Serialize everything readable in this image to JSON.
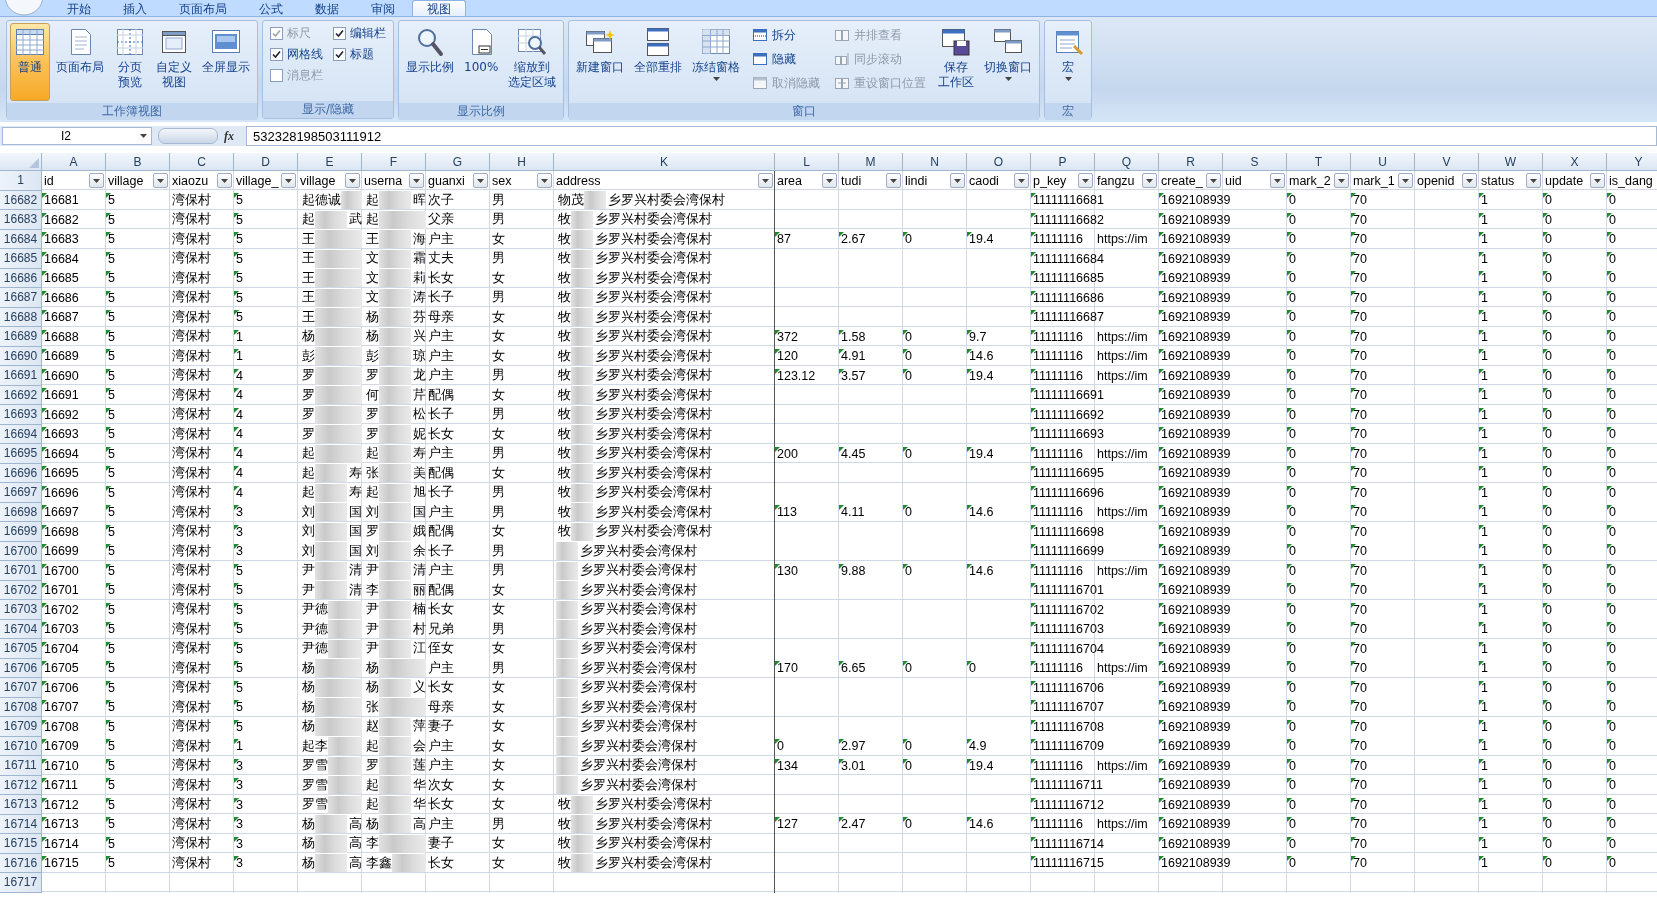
{
  "ribbon": {
    "tabs": [
      {
        "label": "开始",
        "selected": false
      },
      {
        "label": "插入",
        "selected": false
      },
      {
        "label": "页面布局",
        "selected": false
      },
      {
        "label": "公式",
        "selected": false
      },
      {
        "label": "数据",
        "selected": false
      },
      {
        "label": "审阅",
        "selected": false
      },
      {
        "label": "视图",
        "selected": true
      }
    ],
    "groups": [
      {
        "title": "工作簿视图",
        "items": [
          {
            "kind": "large",
            "label": [
              "普通"
            ],
            "selected": true
          },
          {
            "kind": "large",
            "label": [
              "页面布局"
            ],
            "selected": false
          },
          {
            "kind": "large",
            "label": [
              "分页",
              "预览"
            ],
            "selected": false
          },
          {
            "kind": "large",
            "label": [
              "自定义",
              "视图"
            ],
            "selected": false
          },
          {
            "kind": "large",
            "label": [
              "全屏显示"
            ],
            "selected": false
          }
        ]
      },
      {
        "title": "显示/隐藏",
        "items": [
          {
            "kind": "check",
            "label": "标尺",
            "checked": true,
            "disabled": true
          },
          {
            "kind": "check",
            "label": "网格线",
            "checked": true,
            "disabled": false
          },
          {
            "kind": "check",
            "label": "消息栏",
            "checked": false,
            "disabled": true
          },
          {
            "kind": "check",
            "label": "编辑栏",
            "checked": true,
            "disabled": false
          },
          {
            "kind": "check",
            "label": "标题",
            "checked": true,
            "disabled": false
          }
        ]
      },
      {
        "title": "显示比例",
        "items": [
          {
            "kind": "large",
            "label": [
              "显示比例"
            ],
            "selected": false
          },
          {
            "kind": "large",
            "label": [
              "100%"
            ],
            "selected": false
          },
          {
            "kind": "large",
            "label": [
              "缩放到",
              "选定区域"
            ],
            "selected": false
          }
        ]
      },
      {
        "title": "窗口",
        "items": [
          {
            "kind": "large",
            "label": [
              "新建窗口"
            ],
            "selected": false
          },
          {
            "kind": "large",
            "label": [
              "全部重排"
            ],
            "selected": false
          },
          {
            "kind": "large",
            "label": [
              "冻结窗格"
            ],
            "selected": false,
            "dropdown": true
          },
          {
            "kind": "small",
            "label": "拆分",
            "disabled": false
          },
          {
            "kind": "small",
            "label": "隐藏",
            "disabled": false
          },
          {
            "kind": "small",
            "label": "取消隐藏",
            "disabled": true
          },
          {
            "kind": "small",
            "label": "并排查看",
            "disabled": true
          },
          {
            "kind": "small",
            "label": "同步滚动",
            "disabled": true
          },
          {
            "kind": "small",
            "label": "重设窗口位置",
            "disabled": true
          },
          {
            "kind": "large",
            "label": [
              "保存",
              "工作区"
            ],
            "selected": false
          },
          {
            "kind": "large",
            "label": [
              "切换窗口"
            ],
            "selected": false,
            "dropdown": true
          }
        ]
      },
      {
        "title": "宏",
        "items": [
          {
            "kind": "large",
            "label": [
              "宏"
            ],
            "selected": false,
            "dropdown": true
          }
        ]
      }
    ]
  },
  "formula_bar": {
    "name_box": "I2",
    "function_label": "fx",
    "value": "532328198503111912"
  },
  "sheet": {
    "columns": [
      {
        "letter": "A",
        "header": "id",
        "filter": true,
        "flagged": true
      },
      {
        "letter": "B",
        "header": "village",
        "filter": true,
        "flagged": true
      },
      {
        "letter": "C",
        "header": "xiaozu",
        "filter": true,
        "flagged": false
      },
      {
        "letter": "D",
        "header": "village_",
        "filter": true,
        "flagged": true
      },
      {
        "letter": "E",
        "header": "village",
        "filter": true,
        "flagged": false
      },
      {
        "letter": "F",
        "header": "userna",
        "filter": true,
        "flagged": false
      },
      {
        "letter": "G",
        "header": "guanxi",
        "filter": true,
        "flagged": false
      },
      {
        "letter": "H",
        "header": "sex",
        "filter": true,
        "flagged": false
      },
      {
        "letter": "K",
        "header": "address",
        "filter": true,
        "flagged": false
      },
      {
        "letter": "L",
        "header": "area",
        "filter": true,
        "flagged": true
      },
      {
        "letter": "M",
        "header": "tudi",
        "filter": true,
        "flagged": true
      },
      {
        "letter": "N",
        "header": "lindi",
        "filter": true,
        "flagged": true
      },
      {
        "letter": "O",
        "header": "caodi",
        "filter": true,
        "flagged": true
      },
      {
        "letter": "P",
        "header": "p_key",
        "filter": true,
        "flagged": true
      },
      {
        "letter": "Q",
        "header": "fangzu",
        "filter": true,
        "flagged": false
      },
      {
        "letter": "R",
        "header": "create_",
        "filter": true,
        "flagged": true
      },
      {
        "letter": "S",
        "header": "uid",
        "filter": true
      },
      {
        "letter": "T",
        "header": "mark_2",
        "filter": true,
        "flagged": true
      },
      {
        "letter": "U",
        "header": "mark_1",
        "filter": true,
        "flagged": true
      },
      {
        "letter": "V",
        "header": "openid",
        "filter": true
      },
      {
        "letter": "W",
        "header": "status",
        "filter": true,
        "flagged": true
      },
      {
        "letter": "X",
        "header": "update",
        "filter": true,
        "flagged": true
      },
      {
        "letter": "Y",
        "header": "is_dang",
        "filter": false,
        "flagged": true
      }
    ],
    "header_row": "1",
    "rows": [
      {
        "row": "16682",
        "cells": [
          "16681",
          "5",
          "湾保村",
          "5",
          [
            "起德诚"
          ],
          [
            "起",
            "晖"
          ],
          "次子",
          "男",
          [
            "物茂",
            "乡罗兴村委会湾保村"
          ],
          null,
          null,
          null,
          null,
          "11111116681",
          null,
          "1692108939",
          null,
          "0",
          "70",
          null,
          "1",
          "0",
          "0"
        ]
      },
      {
        "row": "16683",
        "cells": [
          "16682",
          "5",
          "湾保村",
          "5",
          [
            "起",
            "武"
          ],
          [
            "起"
          ],
          "父亲",
          "男",
          [
            "牧",
            "乡罗兴村委会湾保村"
          ],
          null,
          null,
          null,
          null,
          "11111116682",
          null,
          "1692108939",
          null,
          "0",
          "70",
          null,
          "1",
          "0",
          "0"
        ]
      },
      {
        "row": "16684",
        "cells": [
          "16683",
          "5",
          "湾保村",
          "5",
          [
            "王"
          ],
          [
            "王",
            "海"
          ],
          "户主",
          "女",
          [
            "牧",
            "乡罗兴村委会湾保村"
          ],
          "87",
          "2.67",
          "0",
          "19.4",
          "11111116",
          "https://im",
          "1692108939",
          null,
          "0",
          "70",
          null,
          "1",
          "0",
          "0"
        ]
      },
      {
        "row": "16685",
        "cells": [
          "16684",
          "5",
          "湾保村",
          "5",
          [
            "王"
          ],
          [
            "文",
            "霜"
          ],
          "丈夫",
          "男",
          [
            "牧",
            "乡罗兴村委会湾保村"
          ],
          null,
          null,
          null,
          null,
          "11111116684",
          null,
          "1692108939",
          null,
          "0",
          "70",
          null,
          "1",
          "0",
          "0"
        ]
      },
      {
        "row": "16686",
        "cells": [
          "16685",
          "5",
          "湾保村",
          "5",
          [
            "王"
          ],
          [
            "文",
            "莉"
          ],
          "长女",
          "女",
          [
            "牧",
            "乡罗兴村委会湾保村"
          ],
          null,
          null,
          null,
          null,
          "11111116685",
          null,
          "1692108939",
          null,
          "0",
          "70",
          null,
          "1",
          "0",
          "0"
        ]
      },
      {
        "row": "16687",
        "cells": [
          "16686",
          "5",
          "湾保村",
          "5",
          [
            "王"
          ],
          [
            "文",
            "涛"
          ],
          "长子",
          "男",
          [
            "牧",
            "乡罗兴村委会湾保村"
          ],
          null,
          null,
          null,
          null,
          "11111116686",
          null,
          "1692108939",
          null,
          "0",
          "70",
          null,
          "1",
          "0",
          "0"
        ]
      },
      {
        "row": "16688",
        "cells": [
          "16687",
          "5",
          "湾保村",
          "5",
          [
            "王"
          ],
          [
            "杨",
            "芬"
          ],
          "母亲",
          "女",
          [
            "牧",
            "乡罗兴村委会湾保村"
          ],
          null,
          null,
          null,
          null,
          "11111116687",
          null,
          "1692108939",
          null,
          "0",
          "70",
          null,
          "1",
          "0",
          "0"
        ]
      },
      {
        "row": "16689",
        "cells": [
          "16688",
          "5",
          "湾保村",
          "1",
          [
            "杨"
          ],
          [
            "杨",
            "兴"
          ],
          "户主",
          "女",
          [
            "牧",
            "乡罗兴村委会湾保村"
          ],
          "372",
          "1.58",
          "0",
          "9.7",
          "11111116",
          "https://im",
          "1692108939",
          null,
          "0",
          "70",
          null,
          "1",
          "0",
          "0"
        ]
      },
      {
        "row": "16690",
        "cells": [
          "16689",
          "5",
          "湾保村",
          "1",
          [
            "彭"
          ],
          [
            "彭",
            "琼"
          ],
          "户主",
          "女",
          [
            "牧",
            "乡罗兴村委会湾保村"
          ],
          "120",
          "4.91",
          "0",
          "14.6",
          "11111116",
          "https://im",
          "1692108939",
          null,
          "0",
          "70",
          null,
          "1",
          "0",
          "0"
        ]
      },
      {
        "row": "16691",
        "cells": [
          "16690",
          "5",
          "湾保村",
          "4",
          [
            "罗"
          ],
          [
            "罗",
            "龙"
          ],
          "户主",
          "男",
          [
            "牧",
            "乡罗兴村委会湾保村"
          ],
          "123.12",
          "3.57",
          "0",
          "19.4",
          "11111116",
          "https://im",
          "1692108939",
          null,
          "0",
          "70",
          null,
          "1",
          "0",
          "0"
        ]
      },
      {
        "row": "16692",
        "cells": [
          "16691",
          "5",
          "湾保村",
          "4",
          [
            "罗"
          ],
          [
            "何",
            "芹"
          ],
          "配偶",
          "女",
          [
            "牧",
            "乡罗兴村委会湾保村"
          ],
          null,
          null,
          null,
          null,
          "11111116691",
          null,
          "1692108939",
          null,
          "0",
          "70",
          null,
          "1",
          "0",
          "0"
        ]
      },
      {
        "row": "16693",
        "cells": [
          "16692",
          "5",
          "湾保村",
          "4",
          [
            "罗"
          ],
          [
            "罗",
            "松"
          ],
          "长子",
          "男",
          [
            "牧",
            "乡罗兴村委会湾保村"
          ],
          null,
          null,
          null,
          null,
          "11111116692",
          null,
          "1692108939",
          null,
          "0",
          "70",
          null,
          "1",
          "0",
          "0"
        ]
      },
      {
        "row": "16694",
        "cells": [
          "16693",
          "5",
          "湾保村",
          "4",
          [
            "罗"
          ],
          [
            "罗",
            "妮"
          ],
          "长女",
          "女",
          [
            "牧",
            "乡罗兴村委会湾保村"
          ],
          null,
          null,
          null,
          null,
          "11111116693",
          null,
          "1692108939",
          null,
          "0",
          "70",
          null,
          "1",
          "0",
          "0"
        ]
      },
      {
        "row": "16695",
        "cells": [
          "16694",
          "5",
          "湾保村",
          "4",
          [
            "起"
          ],
          [
            "起",
            "寿"
          ],
          "户主",
          "男",
          [
            "牧",
            "乡罗兴村委会湾保村"
          ],
          "200",
          "4.45",
          "0",
          "19.4",
          "11111116",
          "https://im",
          "1692108939",
          null,
          "0",
          "70",
          null,
          "1",
          "0",
          "0"
        ]
      },
      {
        "row": "16696",
        "cells": [
          "16695",
          "5",
          "湾保村",
          "4",
          [
            "起",
            "寿"
          ],
          [
            "张",
            "美"
          ],
          "配偶",
          "女",
          [
            "牧",
            "乡罗兴村委会湾保村"
          ],
          null,
          null,
          null,
          null,
          "11111116695",
          null,
          "1692108939",
          null,
          "0",
          "70",
          null,
          "1",
          "0",
          "0"
        ]
      },
      {
        "row": "16697",
        "cells": [
          "16696",
          "5",
          "湾保村",
          "4",
          [
            "起",
            "寿"
          ],
          [
            "起",
            "旭"
          ],
          "长子",
          "男",
          [
            "牧",
            "乡罗兴村委会湾保村"
          ],
          null,
          null,
          null,
          null,
          "11111116696",
          null,
          "1692108939",
          null,
          "0",
          "70",
          null,
          "1",
          "0",
          "0"
        ]
      },
      {
        "row": "16698",
        "cells": [
          "16697",
          "5",
          "湾保村",
          "3",
          [
            "刘",
            "国"
          ],
          [
            "刘",
            "国"
          ],
          "户主",
          "男",
          [
            "牧",
            "乡罗兴村委会湾保村"
          ],
          "113",
          "4.11",
          "0",
          "14.6",
          "11111116",
          "https://im",
          "1692108939",
          null,
          "0",
          "70",
          null,
          "1",
          "0",
          "0"
        ]
      },
      {
        "row": "16699",
        "cells": [
          "16698",
          "5",
          "湾保村",
          "3",
          [
            "刘",
            "国"
          ],
          [
            "罗",
            "娥"
          ],
          "配偶",
          "女",
          [
            "牧",
            "乡罗兴村委会湾保村"
          ],
          null,
          null,
          null,
          null,
          "11111116698",
          null,
          "1692108939",
          null,
          "0",
          "70",
          null,
          "1",
          "0",
          "0"
        ]
      },
      {
        "row": "16700",
        "cells": [
          "16699",
          "5",
          "湾保村",
          "3",
          [
            "刘",
            "国"
          ],
          [
            "刘",
            "余"
          ],
          "长子",
          "男",
          [
            "乡罗兴村委会湾保村"
          ],
          null,
          null,
          null,
          null,
          "11111116699",
          null,
          "1692108939",
          null,
          "0",
          "70",
          null,
          "1",
          "0",
          "0"
        ]
      },
      {
        "row": "16701",
        "cells": [
          "16700",
          "5",
          "湾保村",
          "5",
          [
            "尹",
            "清"
          ],
          [
            "尹",
            "清"
          ],
          "户主",
          "男",
          [
            "乡罗兴村委会湾保村"
          ],
          "130",
          "9.88",
          "0",
          "14.6",
          "11111116",
          "https://im",
          "1692108939",
          null,
          "0",
          "70",
          null,
          "1",
          "0",
          "0"
        ]
      },
      {
        "row": "16702",
        "cells": [
          "16701",
          "5",
          "湾保村",
          "5",
          [
            "尹",
            "清"
          ],
          [
            "李",
            "丽"
          ],
          "配偶",
          "女",
          [
            "乡罗兴村委会湾保村"
          ],
          null,
          null,
          null,
          null,
          "11111116701",
          null,
          "1692108939",
          null,
          "0",
          "70",
          null,
          "1",
          "0",
          "0"
        ]
      },
      {
        "row": "16703",
        "cells": [
          "16702",
          "5",
          "湾保村",
          "5",
          [
            "尹德"
          ],
          [
            "尹",
            "楠"
          ],
          "长女",
          "女",
          [
            "乡罗兴村委会湾保村"
          ],
          null,
          null,
          null,
          null,
          "11111116702",
          null,
          "1692108939",
          null,
          "0",
          "70",
          null,
          "1",
          "0",
          "0"
        ]
      },
      {
        "row": "16704",
        "cells": [
          "16703",
          "5",
          "湾保村",
          "5",
          [
            "尹德"
          ],
          [
            "尹",
            "村"
          ],
          "兄弟",
          "男",
          [
            "乡罗兴村委会湾保村"
          ],
          null,
          null,
          null,
          null,
          "11111116703",
          null,
          "1692108939",
          null,
          "0",
          "70",
          null,
          "1",
          "0",
          "0"
        ]
      },
      {
        "row": "16705",
        "cells": [
          "16704",
          "5",
          "湾保村",
          "5",
          [
            "尹德"
          ],
          [
            "尹",
            "江"
          ],
          "侄女",
          "女",
          [
            "乡罗兴村委会湾保村"
          ],
          null,
          null,
          null,
          null,
          "11111116704",
          null,
          "1692108939",
          null,
          "0",
          "70",
          null,
          "1",
          "0",
          "0"
        ]
      },
      {
        "row": "16706",
        "cells": [
          "16705",
          "5",
          "湾保村",
          "5",
          [
            "杨"
          ],
          [
            "杨"
          ],
          "户主",
          "男",
          [
            "乡罗兴村委会湾保村"
          ],
          "170",
          "6.65",
          "0",
          "0",
          "11111116",
          "https://im",
          "1692108939",
          null,
          "0",
          "70",
          null,
          "1",
          "0",
          "0"
        ]
      },
      {
        "row": "16707",
        "cells": [
          "16706",
          "5",
          "湾保村",
          "5",
          [
            "杨"
          ],
          [
            "杨",
            "义"
          ],
          "长女",
          "女",
          [
            "乡罗兴村委会湾保村"
          ],
          null,
          null,
          null,
          null,
          "11111116706",
          null,
          "1692108939",
          null,
          "0",
          "70",
          null,
          "1",
          "0",
          "0"
        ]
      },
      {
        "row": "16708",
        "cells": [
          "16707",
          "5",
          "湾保村",
          "5",
          [
            "杨"
          ],
          [
            "张"
          ],
          "母亲",
          "女",
          [
            "乡罗兴村委会湾保村"
          ],
          null,
          null,
          null,
          null,
          "11111116707",
          null,
          "1692108939",
          null,
          "0",
          "70",
          null,
          "1",
          "0",
          "0"
        ]
      },
      {
        "row": "16709",
        "cells": [
          "16708",
          "5",
          "湾保村",
          "5",
          [
            "杨"
          ],
          [
            "赵",
            "萍"
          ],
          "妻子",
          "女",
          [
            "乡罗兴村委会湾保村"
          ],
          null,
          null,
          null,
          null,
          "11111116708",
          null,
          "1692108939",
          null,
          "0",
          "70",
          null,
          "1",
          "0",
          "0"
        ]
      },
      {
        "row": "16710",
        "cells": [
          "16709",
          "5",
          "湾保村",
          "1",
          [
            "起李"
          ],
          [
            "起",
            "会"
          ],
          "户主",
          "女",
          [
            "乡罗兴村委会湾保村"
          ],
          "0",
          "2.97",
          "0",
          "4.9",
          "11111116709",
          null,
          "1692108939",
          null,
          "0",
          "70",
          null,
          "1",
          "0",
          "0"
        ]
      },
      {
        "row": "16711",
        "cells": [
          "16710",
          "5",
          "湾保村",
          "3",
          [
            "罗雪"
          ],
          [
            "罗",
            "莲"
          ],
          "户主",
          "女",
          [
            "乡罗兴村委会湾保村"
          ],
          "134",
          "3.01",
          "0",
          "19.4",
          "11111116",
          "https://im",
          "1692108939",
          null,
          "0",
          "70",
          null,
          "1",
          "0",
          "0"
        ]
      },
      {
        "row": "16712",
        "cells": [
          "16711",
          "5",
          "湾保村",
          "3",
          [
            "罗雪"
          ],
          [
            "起",
            "华"
          ],
          "次女",
          "女",
          [
            "乡罗兴村委会湾保村"
          ],
          null,
          null,
          null,
          null,
          "11111116711",
          null,
          "1692108939",
          null,
          "0",
          "70",
          null,
          "1",
          "0",
          "0"
        ]
      },
      {
        "row": "16713",
        "cells": [
          "16712",
          "5",
          "湾保村",
          "3",
          [
            "罗雪"
          ],
          [
            "起",
            "华"
          ],
          "长女",
          "女",
          [
            "牧",
            "乡罗兴村委会湾保村"
          ],
          null,
          null,
          null,
          null,
          "11111116712",
          null,
          "1692108939",
          null,
          "0",
          "70",
          null,
          "1",
          "0",
          "0"
        ]
      },
      {
        "row": "16714",
        "cells": [
          "16713",
          "5",
          "湾保村",
          "3",
          [
            "杨",
            "高"
          ],
          [
            "杨",
            "高"
          ],
          "户主",
          "男",
          [
            "牧",
            "乡罗兴村委会湾保村"
          ],
          "127",
          "2.47",
          "0",
          "14.6",
          "11111116",
          "https://im",
          "1692108939",
          null,
          "0",
          "70",
          null,
          "1",
          "0",
          "0"
        ]
      },
      {
        "row": "16715",
        "cells": [
          "16714",
          "5",
          "湾保村",
          "3",
          [
            "杨",
            "高"
          ],
          [
            "李"
          ],
          "妻子",
          "女",
          [
            "牧",
            "乡罗兴村委会湾保村"
          ],
          null,
          null,
          null,
          null,
          "11111116714",
          null,
          "1692108939",
          null,
          "0",
          "70",
          null,
          "1",
          "0",
          "0"
        ]
      },
      {
        "row": "16716",
        "cells": [
          "16715",
          "5",
          "湾保村",
          "3",
          [
            "杨",
            "高"
          ],
          [
            "李鑫"
          ],
          "长女",
          "女",
          [
            "牧",
            "乡罗兴村委会湾保村"
          ],
          null,
          null,
          null,
          null,
          "11111116715",
          null,
          "1692108939",
          null,
          "0",
          "70",
          null,
          "1",
          "0",
          "0"
        ]
      },
      {
        "row": "16717",
        "cells": []
      }
    ]
  }
}
